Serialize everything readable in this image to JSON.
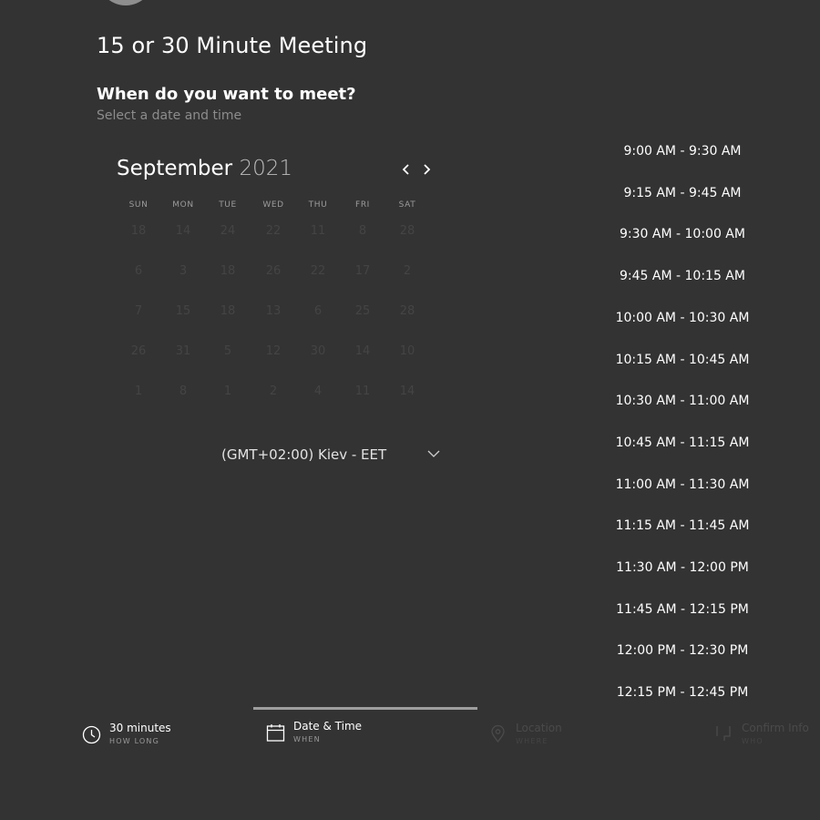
{
  "meeting": {
    "title": "15 or 30 Minute Meeting",
    "heading": "When do you want to meet?",
    "subheading": "Select a date and time"
  },
  "calendar": {
    "month": "September",
    "year": "2021",
    "weekdays": [
      "SUN",
      "MON",
      "TUE",
      "WED",
      "THU",
      "FRI",
      "SAT"
    ],
    "rows": [
      [
        "18",
        "14",
        "24",
        "22",
        "11",
        "8",
        "28"
      ],
      [
        "6",
        "3",
        "18",
        "26",
        "22",
        "17",
        "2"
      ],
      [
        "7",
        "15",
        "18",
        "13",
        "6",
        "25",
        "28"
      ],
      [
        "26",
        "31",
        "5",
        "12",
        "30",
        "14",
        "10"
      ],
      [
        "1",
        "8",
        "1",
        "2",
        "4",
        "11",
        "14"
      ]
    ],
    "timezone": "(GMT+02:00) Kiev - EET"
  },
  "time_slots": [
    "9:00 AM - 9:30 AM",
    "9:15 AM - 9:45 AM",
    "9:30 AM - 10:00 AM",
    "9:45 AM - 10:15 AM",
    "10:00 AM - 10:30 AM",
    "10:15 AM - 10:45 AM",
    "10:30 AM - 11:00 AM",
    "10:45 AM - 11:15 AM",
    "11:00 AM - 11:30 AM",
    "11:15 AM - 11:45 AM",
    "11:30 AM - 12:00 PM",
    "11:45 AM - 12:15 PM",
    "12:00 PM - 12:30 PM",
    "12:15 PM - 12:45 PM"
  ],
  "steps": [
    {
      "title": "30 minutes",
      "sub": "HOW LONG",
      "icon": "clock-icon"
    },
    {
      "title": "Date & Time",
      "sub": "WHEN",
      "icon": "calendar-icon"
    },
    {
      "title": "Location",
      "sub": "WHERE",
      "icon": "location-pin-icon"
    },
    {
      "title": "Confirm Info",
      "sub": "WHO",
      "icon": "confirm-info-icon"
    }
  ],
  "colors": {
    "background": "#333333",
    "text": "#ffffff",
    "muted": "#8c8c8c",
    "disabled_day": "#444444",
    "active_step_bar": "#9e9e9e"
  }
}
